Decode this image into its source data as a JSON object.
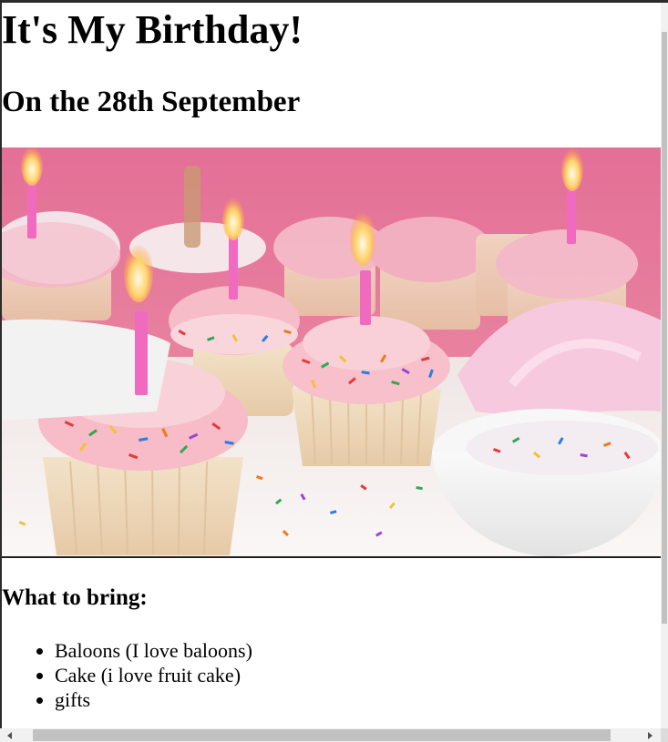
{
  "page": {
    "title": "It's My Birthday!",
    "subtitle": "On the 28th September",
    "bring_heading": "What to bring:",
    "bring_items": [
      "Baloons (I love baloons)",
      "Cake (i love fruit cake)",
      "gifts"
    ]
  },
  "image": {
    "subject": "cupcakes-with-candles-and-sprinkles",
    "colors": {
      "background_pink": "#e46f97",
      "frosting": "#f7b6c2",
      "candle": "#f06bc0",
      "cup": "#f1dcc0",
      "bowl": "#f3f3f3"
    }
  },
  "scrollbars": {
    "vertical": true,
    "horizontal": true
  }
}
